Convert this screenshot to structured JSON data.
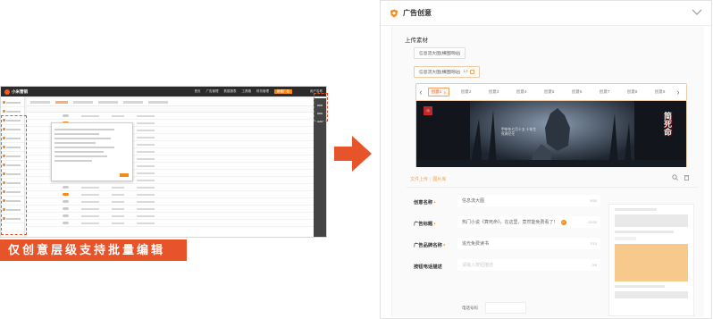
{
  "caption": "仅创意层级支持批量编辑",
  "mini_app": {
    "title": "小米营销",
    "nav": [
      "首页",
      "广告管理",
      "数据报表",
      "工具箱",
      "财务管理",
      "新建广告"
    ],
    "user": "用户名称"
  },
  "panel": {
    "title": "广告创意",
    "upload_title": "上传素材",
    "buttons": {
      "preset_image": "信息流大图(横图网站)",
      "selected_image": "信息流大图(横图网站)",
      "selected_count": "13"
    },
    "tabs": [
      "创意1",
      "创意2",
      "创意3",
      "创意4",
      "创意5",
      "创意6",
      "创意7",
      "创意8",
      "创意9"
    ],
    "image": {
      "overlay_text": "甲申年七月十五 十年生死两茫茫",
      "brand": "简死命"
    },
    "file_actions": {
      "upload": "文件上传",
      "gallery": "图片库"
    },
    "form": {
      "creative_name": {
        "label": "创意名称",
        "value": "信息流大图",
        "count": "5/50"
      },
      "ad_title": {
        "label": "广告标题",
        "value": "热门小说《算死命》，在这里，竟然能免费看了！",
        "count": "22/30"
      },
      "brand_name": {
        "label": "广告品牌名称",
        "value": "追光免费读书",
        "count": "7/10"
      },
      "cta": {
        "label": "按钮电话描述",
        "placeholder": "请输入按钮描述",
        "count": "0/6"
      },
      "phone": {
        "label": "电话号码"
      }
    }
  },
  "colors": {
    "accent": "#e8542a",
    "orange": "#f28a1e"
  }
}
